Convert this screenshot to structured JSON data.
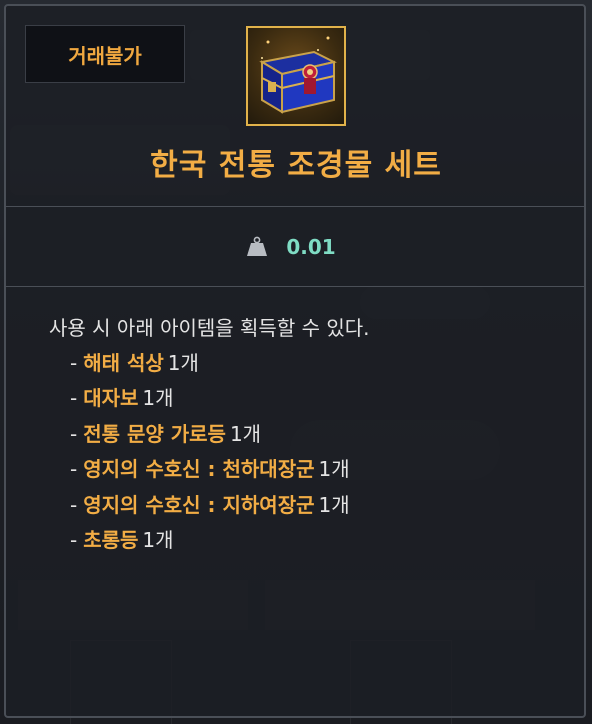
{
  "badge": {
    "label": "거래불가"
  },
  "item": {
    "icon": "treasure-chest-icon",
    "title": "한국 전통 조경물 세트"
  },
  "weight": {
    "icon": "weight-icon",
    "value": "0.01"
  },
  "description": "사용 시 아래 아이템을 획득할 수 있다.",
  "rewards": [
    {
      "dash": "-",
      "name": "해태 석상",
      "qty": "1개"
    },
    {
      "dash": "-",
      "name": "대자보",
      "qty": "1개"
    },
    {
      "dash": "-",
      "name": "전통 문양 가로등",
      "qty": "1개"
    },
    {
      "dash": "-",
      "name": "영지의 수호신 : 천하대장군",
      "qty": "1개"
    },
    {
      "dash": "-",
      "name": "영지의 수호신 : 지하여장군",
      "qty": "1개"
    },
    {
      "dash": "-",
      "name": "초롱등",
      "qty": "1개"
    }
  ],
  "colors": {
    "accent": "#f2ad45",
    "weight_value": "#7fdcc4",
    "border": "#4a4f57",
    "text": "#e4e4e4"
  }
}
